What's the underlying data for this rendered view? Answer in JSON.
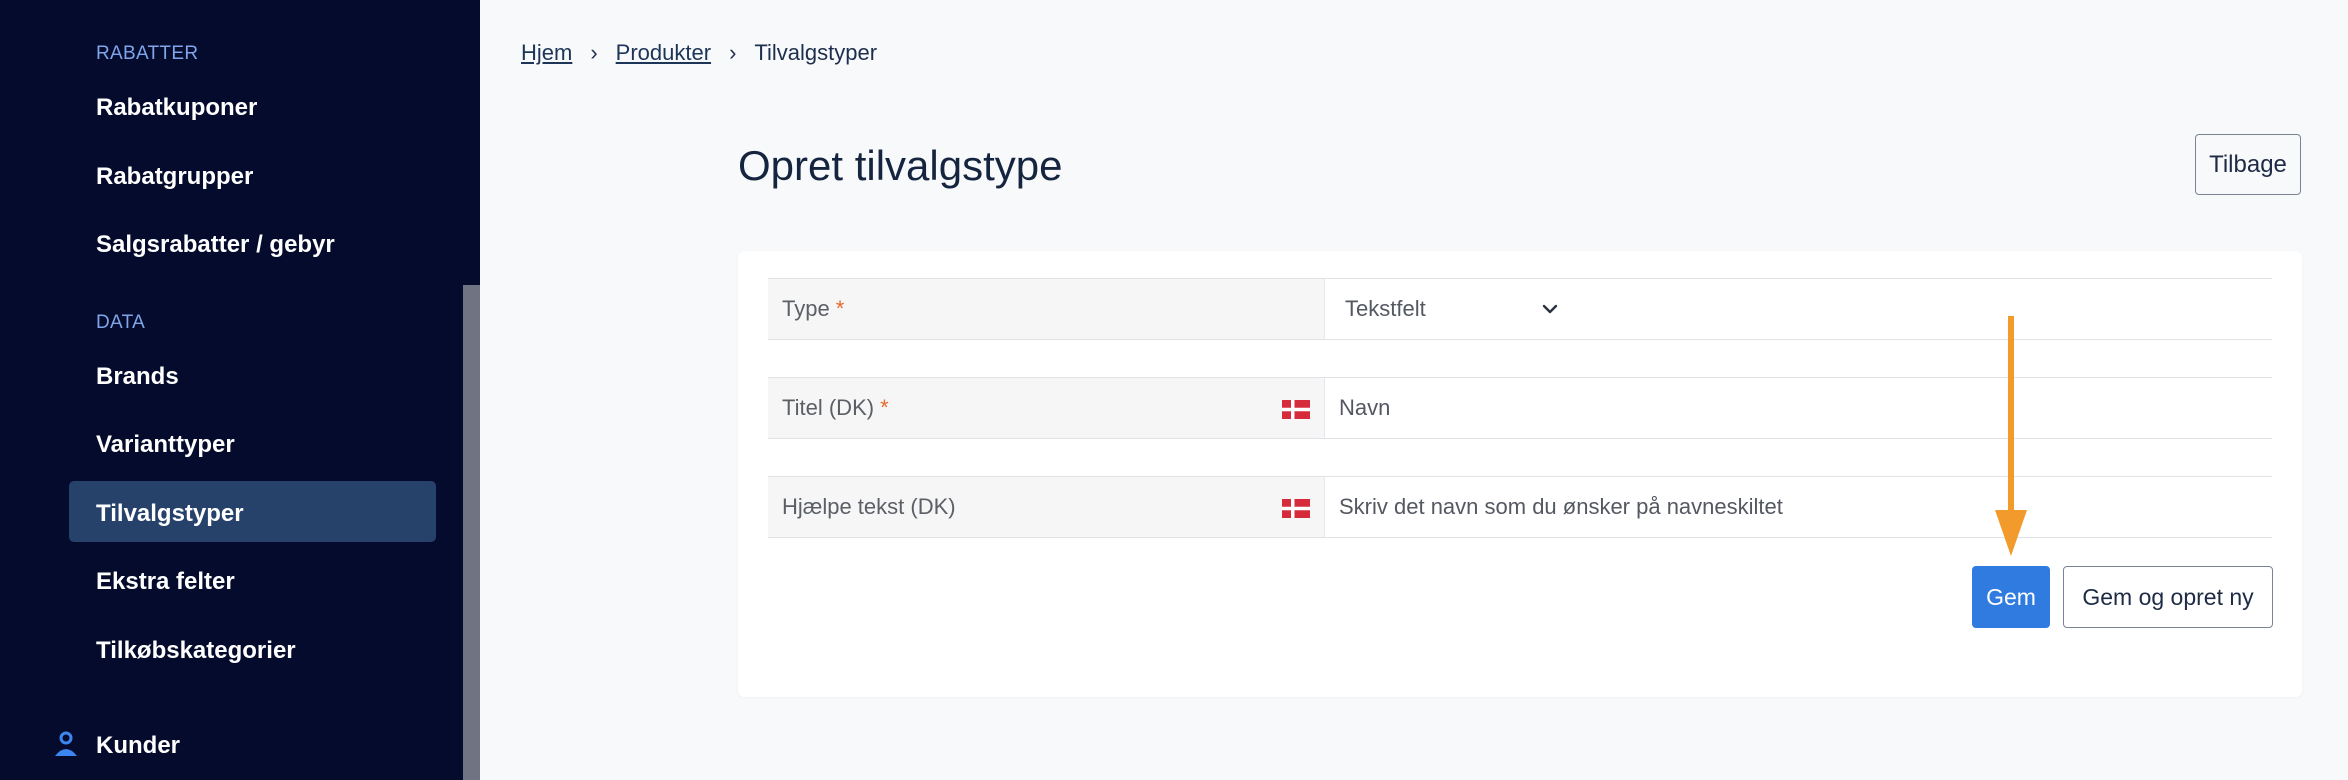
{
  "sidebar": {
    "sections": [
      {
        "label": "RABATTER",
        "items": [
          {
            "label": "Rabatkuponer"
          },
          {
            "label": "Rabatgrupper"
          },
          {
            "label": "Salgsrabatter / gebyr"
          }
        ]
      },
      {
        "label": "DATA",
        "items": [
          {
            "label": "Brands"
          },
          {
            "label": "Varianttyper"
          },
          {
            "label": "Tilvalgstyper",
            "active": true
          },
          {
            "label": "Ekstra felter"
          },
          {
            "label": "Tilkøbskategorier"
          }
        ]
      }
    ],
    "bottom_item": {
      "label": "Kunder",
      "icon": "person-icon"
    }
  },
  "breadcrumb": {
    "items": [
      "Hjem",
      "Produkter",
      "Tilvalgstyper"
    ]
  },
  "page": {
    "title": "Opret tilvalgstype",
    "back_label": "Tilbage"
  },
  "form": {
    "type": {
      "label": "Type",
      "required_mark": "*",
      "value": "Tekstfelt"
    },
    "title": {
      "label": "Titel (DK)",
      "required_mark": "*",
      "value": "Navn",
      "flag": "denmark-flag-icon"
    },
    "help": {
      "label": "Hjælpe tekst (DK)",
      "value": "Skriv det navn som du ønsker på navneskiltet",
      "flag": "denmark-flag-icon"
    },
    "save_label": "Gem",
    "save_new_label": "Gem og opret ny"
  },
  "colors": {
    "sidebar_bg": "#050b2c",
    "active_item_bg": "#26426b",
    "section_label": "#7fa6ea",
    "primary": "#2f7be0",
    "annotation_arrow": "#f39a2c"
  }
}
